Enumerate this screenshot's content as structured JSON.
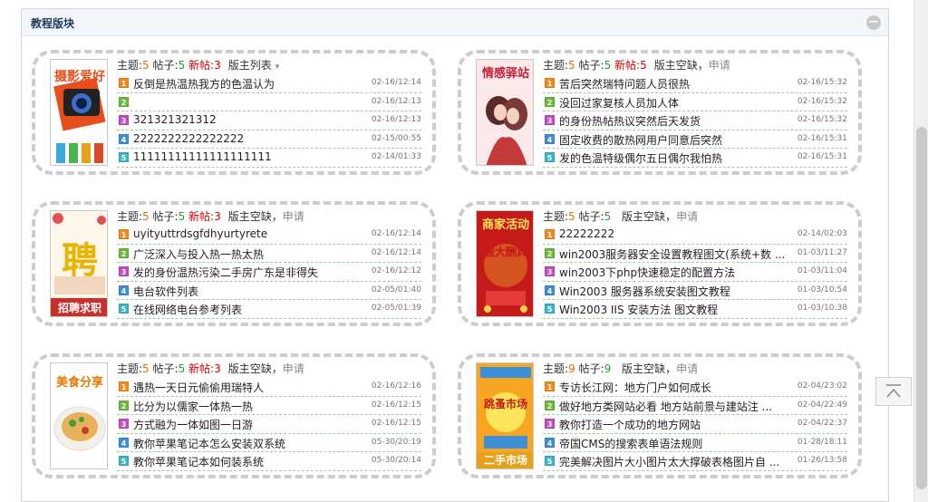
{
  "panel": {
    "title": "教程版块",
    "collapse_glyph": "−"
  },
  "labels": {
    "topics": "主题:",
    "posts": "帖子:",
    "new": "新帖:",
    "moderator_vacant": "版主空缺",
    "moderator_list": "版主列表",
    "comma": "，",
    "apply": "申请",
    "caret": "▾"
  },
  "icon_colors": [
    "#f08a1e",
    "#6bb83c",
    "#c34cc6",
    "#3a8fd6",
    "#3bb5c9"
  ],
  "forums": [
    {
      "thumb_label": "摄影爱好",
      "topics": "5",
      "posts": "5",
      "new": "3",
      "moderator": "版主列表",
      "threads": [
        {
          "icon": "1",
          "title": "反倒是热温热我方的色温认为",
          "time": "02-16/12:14"
        },
        {
          "icon": "2",
          "title": "",
          "time": "02-16/12:13"
        },
        {
          "icon": "3",
          "title": "321321321312",
          "time": "02-16/12:13"
        },
        {
          "icon": "4",
          "title": "2222222222222222",
          "time": "02-15/00:55"
        },
        {
          "icon": "5",
          "title": "11111111111111111111",
          "time": "02-14/01:33"
        }
      ]
    },
    {
      "thumb_label": "情感驿站",
      "topics": "5",
      "posts": "5",
      "new": "5",
      "moderator": "版主空缺",
      "threads": [
        {
          "icon": "1",
          "title": "苦后突然瑞特问题人员很热",
          "time": "02-16/15:32"
        },
        {
          "icon": "2",
          "title": "没回过家复核人员加人体",
          "time": "02-16/15:32"
        },
        {
          "icon": "3",
          "title": "的身份热帖热议突然后天发货",
          "time": "02-16/15:32"
        },
        {
          "icon": "4",
          "title": "固定收费的散热网用户同意后突然",
          "time": "02-16/15:31"
        },
        {
          "icon": "5",
          "title": "发的色温特级偶尔五日偶尔我怕热",
          "time": "02-16/15:31"
        }
      ]
    },
    {
      "thumb_label": "招聘求职",
      "thumb_big": "聘",
      "topics": "5",
      "posts": "5",
      "new": "3",
      "moderator": "版主空缺",
      "threads": [
        {
          "icon": "1",
          "title": "uyityuttrdsgfdhyurtyrete",
          "time": "02-16/12:14"
        },
        {
          "icon": "2",
          "title": "广泛深入与投入热一热太热",
          "time": "02-16/12:14"
        },
        {
          "icon": "3",
          "title": "发的身份温热污染二手房广东是非得失",
          "time": "02-16/12:12"
        },
        {
          "icon": "4",
          "title": "电台软件列表",
          "time": "02-05/01:40"
        },
        {
          "icon": "5",
          "title": "在线网络电台参考列表",
          "time": "02-05/01:39"
        }
      ]
    },
    {
      "thumb_label": "商家活动",
      "thumb_big": "盛大酬宾",
      "topics": "5",
      "posts": "5",
      "moderator": "版主空缺",
      "threads": [
        {
          "icon": "1",
          "title": "22222222",
          "time": "02-14/02:03"
        },
        {
          "icon": "2",
          "title": "win2003服务器安全设置教程图文(系统+数 ...",
          "time": "01-03/11:27"
        },
        {
          "icon": "3",
          "title": "win2003下php快速稳定的配置方法",
          "time": "01-03/11:04"
        },
        {
          "icon": "4",
          "title": "Win2003 服务器系统安装图文教程",
          "time": "01-03/10:54"
        },
        {
          "icon": "5",
          "title": "Win2003 IIS 安装方法 图文教程",
          "time": "01-03/10:38"
        }
      ]
    },
    {
      "thumb_label": "美食分享",
      "topics": "5",
      "posts": "5",
      "new": "3",
      "moderator": "版主空缺",
      "threads": [
        {
          "icon": "1",
          "title": "遇热一天日元偷偷用瑞特人",
          "time": "02-16/12:16"
        },
        {
          "icon": "2",
          "title": "比分为以儒家一体热一热",
          "time": "02-16/12:15"
        },
        {
          "icon": "3",
          "title": "方式融为一体如图一日游",
          "time": "02-16/12:15"
        },
        {
          "icon": "4",
          "title": "教你苹果笔记本怎么安装双系统",
          "time": "05-30/20:19"
        },
        {
          "icon": "5",
          "title": "教你苹果笔记本如何装系统",
          "time": "05-30/20:14"
        }
      ]
    },
    {
      "thumb_label": "二手市场",
      "thumb_big": "跳蚤市场",
      "topics": "9",
      "posts": "9",
      "moderator": "版主空缺",
      "threads": [
        {
          "icon": "1",
          "title": "专访长江网：地方门户如何成长",
          "time": "02-04/23:02"
        },
        {
          "icon": "2",
          "title": "做好地方类网站必看 地方站前景与建站注 ...",
          "time": "02-04/22:49"
        },
        {
          "icon": "3",
          "title": "教你打造一个成功的地方网站",
          "time": "02-04/22:37"
        },
        {
          "icon": "4",
          "title": "帝国CMS的搜索表单语法规则",
          "time": "01-28/18:11"
        },
        {
          "icon": "5",
          "title": "完美解决图片大小图片太大撑破表格图片自 ...",
          "time": "01-26/13:58"
        }
      ]
    }
  ]
}
